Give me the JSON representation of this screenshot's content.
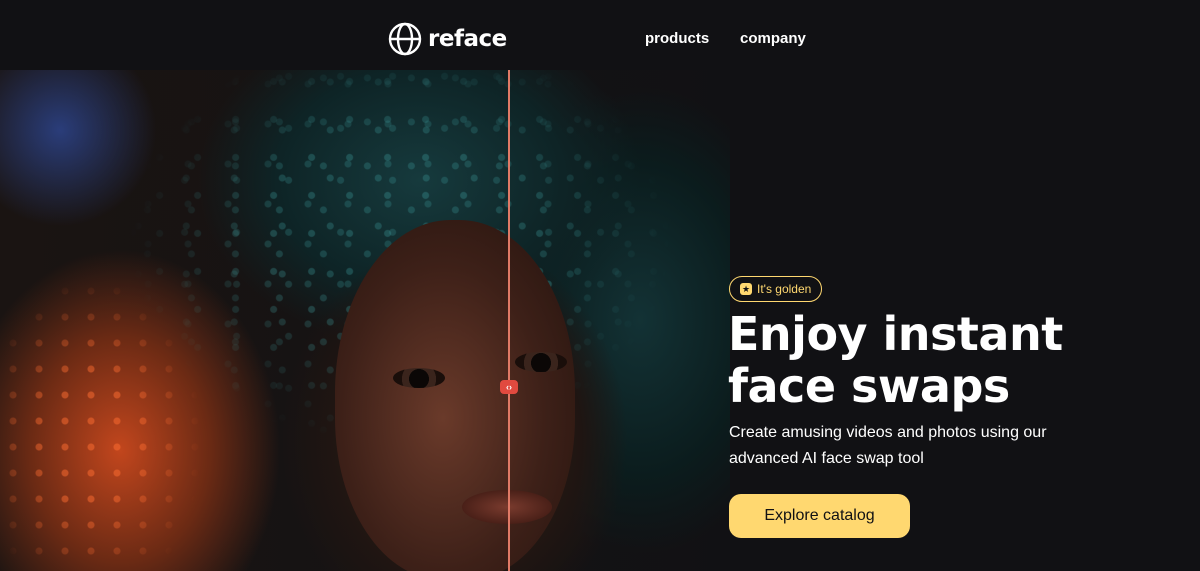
{
  "header": {
    "logo_text": "reface",
    "logo_icon": "reface-globe-icon",
    "nav": [
      {
        "label": "products"
      },
      {
        "label": "company"
      }
    ]
  },
  "hero": {
    "compare_handle_icon": "arrows-left-right-icon",
    "compare_handle_glyph": "‹›"
  },
  "content": {
    "badge": {
      "icon": "star-icon",
      "label": "It's golden"
    },
    "headline_line1": "Enjoy instant",
    "headline_line2": "face swaps",
    "subtext_line1": "Create amusing videos and photos using our",
    "subtext_line2": "advanced AI face swap tool",
    "cta_label": "Explore catalog"
  },
  "colors": {
    "background": "#111114",
    "accent": "#ffd870",
    "divider": "#e07a66",
    "handle": "#e14a3f"
  }
}
